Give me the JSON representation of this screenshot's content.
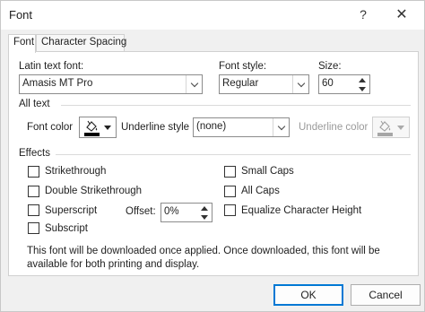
{
  "window": {
    "title": "Font",
    "help_label": "?",
    "close_label": "✕"
  },
  "tabs": [
    {
      "label": "Font",
      "active": true
    },
    {
      "label": "Character Spacing",
      "active": false
    }
  ],
  "font_tab": {
    "latin_font_label": "Latin text font:",
    "latin_font_value": "Amasis MT Pro",
    "font_style_label": "Font style:",
    "font_style_value": "Regular",
    "size_label": "Size:",
    "size_value": "60",
    "all_text_heading": "All text",
    "font_color_label": "Font color",
    "font_color_swatch": "#000000",
    "underline_style_label": "Underline style",
    "underline_style_value": "(none)",
    "underline_color_label": "Underline color",
    "underline_color_swatch": "#a6a6a6",
    "effects_heading": "Effects",
    "effects": {
      "strikethrough": {
        "label": "Strikethrough",
        "checked": false
      },
      "double_strikethrough": {
        "label": "Double Strikethrough",
        "checked": false
      },
      "superscript": {
        "label": "Superscript",
        "checked": false
      },
      "subscript": {
        "label": "Subscript",
        "checked": false
      },
      "small_caps": {
        "label": "Small Caps",
        "checked": false
      },
      "all_caps": {
        "label": "All Caps",
        "checked": false
      },
      "equalize_height": {
        "label": "Equalize Character Height",
        "checked": false
      }
    },
    "offset_label": "Offset:",
    "offset_value": "0%",
    "download_note": "This font will be downloaded once applied. Once downloaded, this font will be available for both printing and display."
  },
  "buttons": {
    "ok": "OK",
    "cancel": "Cancel"
  }
}
